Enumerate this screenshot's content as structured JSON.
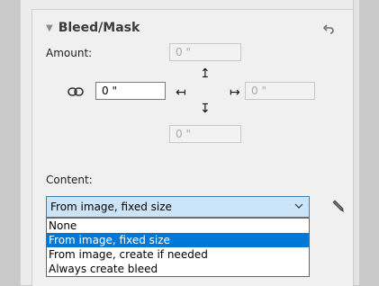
{
  "section": {
    "title": "Bleed/Mask",
    "collapse_icon": "triangle-down-icon",
    "reset_icon": "reset-arrow-icon"
  },
  "amount": {
    "label": "Amount:",
    "top_value": "0 \"",
    "left_value": "0 \"",
    "right_value": "0 \"",
    "bottom_value": "0 \"",
    "link_icon": "chain-link-icon",
    "arrow_up": "↥",
    "arrow_left": "↤",
    "arrow_right": "↦",
    "arrow_down": "↧"
  },
  "content": {
    "label": "Content:",
    "selected": "From image, fixed size",
    "options": [
      "None",
      "From image, fixed size",
      "From image, create if needed",
      "Always create bleed"
    ],
    "selected_index": 1,
    "edit_icon": "pencil-icon",
    "dropdown_icon": "chevron-down-icon"
  },
  "colors": {
    "selected_option": "#0078d7",
    "select_background": "#cce4f7",
    "select_border": "#3c7fb1"
  }
}
